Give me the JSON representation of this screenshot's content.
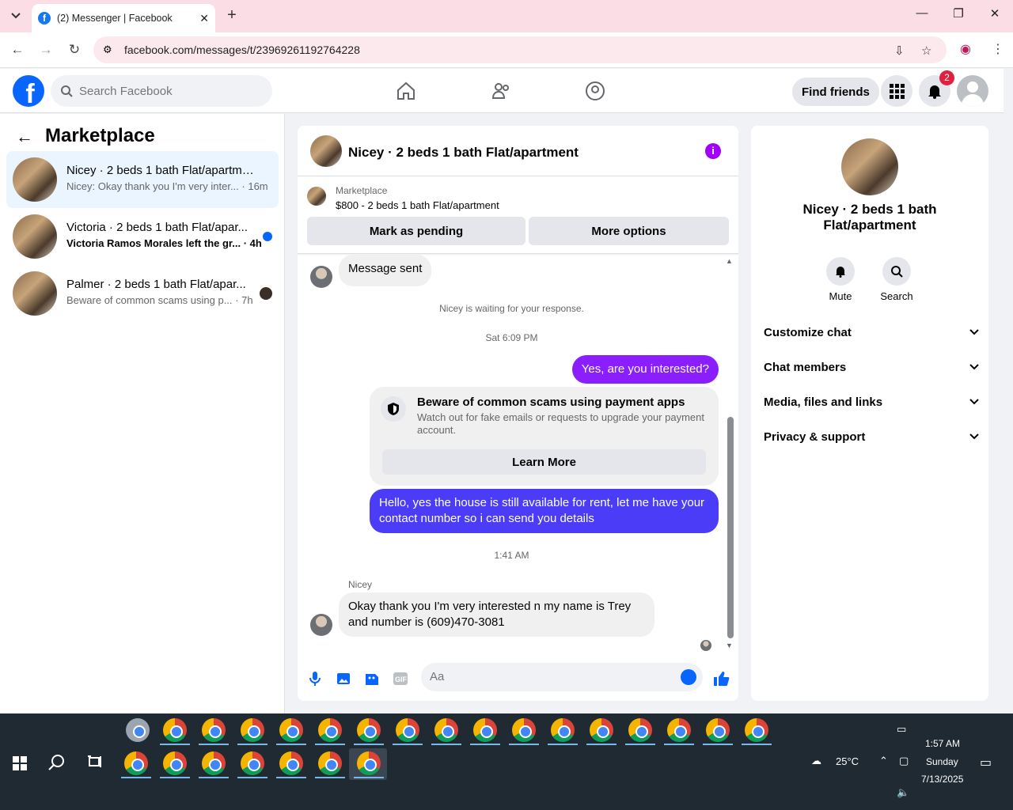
{
  "browser": {
    "tab_title": "(2) Messenger | Facebook",
    "url": "facebook.com/messages/t/23969261192764228"
  },
  "fb": {
    "search_placeholder": "Search Facebook",
    "find_friends": "Find friends",
    "notif_count": "2"
  },
  "left": {
    "title": "Marketplace",
    "conversations": [
      {
        "name": "Nicey · 2 beds 1 bath Flat/apartment",
        "preview": "Nicey: Okay thank you I'm very inter... · 16m"
      },
      {
        "name": "Victoria · 2 beds 1 bath Flat/apar...",
        "preview": "Victoria Ramos Morales left the gr... · 4h"
      },
      {
        "name": "Palmer · 2 beds 1 bath Flat/apar...",
        "preview": "Beware of common scams using p... · 7h"
      }
    ]
  },
  "chat": {
    "title": "Nicey · 2 beds 1 bath Flat/apartment",
    "marketplace_label": "Marketplace",
    "listing": "$800 - 2 beds 1 bath Flat/apartment",
    "mark_pending": "Mark as pending",
    "more_options": "More options",
    "messages": {
      "sent_notice": "Message sent",
      "waiting": "Nicey is waiting for your response.",
      "time1": "Sat 6:09 PM",
      "out1": "Yes, are you interested?",
      "scam_title": "Beware of common scams using payment apps",
      "scam_desc": "Watch out for fake emails or requests to upgrade your payment account.",
      "learn_more": "Learn More",
      "out2": "Hello, yes the house is still available for rent, let me have your contact number so i can send you details",
      "time2": "1:41 AM",
      "sender": "Nicey",
      "in1": "Okay thank you I'm very interested n my name is Trey and number is (609)470-3081"
    },
    "composer_placeholder": "Aa"
  },
  "right": {
    "name": "Nicey · 2 beds 1 bath Flat/apartment",
    "mute": "Mute",
    "search": "Search",
    "rows": [
      "Customize chat",
      "Chat members",
      "Media, files and links",
      "Privacy & support"
    ]
  },
  "taskbar": {
    "weather": "25°C",
    "time": "1:57 AM",
    "day": "Sunday",
    "date": "7/13/2025"
  },
  "colors": {
    "fb_blue": "#0866ff",
    "outgoing_bubble": "#4a3cf7",
    "outgoing_purple": "#8a1eff"
  }
}
